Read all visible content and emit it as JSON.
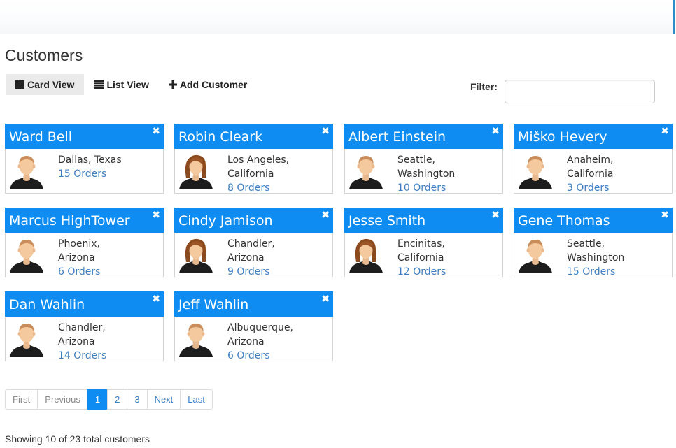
{
  "page": {
    "title": "Customers"
  },
  "toolbar": {
    "card_view": "Card View",
    "list_view": "List View",
    "add_customer": "Add Customer",
    "filter_label": "Filter:",
    "filter_value": ""
  },
  "close_glyph": "✖",
  "customers": [
    {
      "name": "Ward Bell",
      "line1": "Dallas, Texas",
      "line2": "",
      "orders": "15 Orders",
      "gender": "male"
    },
    {
      "name": "Robin Cleark",
      "line1": "Los Angeles,",
      "line2": "California",
      "orders": "8 Orders",
      "gender": "female"
    },
    {
      "name": "Albert Einstein",
      "line1": "Seattle,",
      "line2": "Washington",
      "orders": "10 Orders",
      "gender": "male"
    },
    {
      "name": "Miško Hevery",
      "line1": "Anaheim,",
      "line2": "California",
      "orders": "3 Orders",
      "gender": "male"
    },
    {
      "name": "Marcus HighTower",
      "line1": "Phoenix,",
      "line2": "Arizona",
      "orders": "6 Orders",
      "gender": "male"
    },
    {
      "name": "Cindy Jamison",
      "line1": "Chandler,",
      "line2": "Arizona",
      "orders": "9 Orders",
      "gender": "female"
    },
    {
      "name": "Jesse Smith",
      "line1": "Encinitas,",
      "line2": "California",
      "orders": "12 Orders",
      "gender": "female"
    },
    {
      "name": "Gene Thomas",
      "line1": "Seattle,",
      "line2": "Washington",
      "orders": "15 Orders",
      "gender": "male"
    },
    {
      "name": "Dan Wahlin",
      "line1": "Chandler,",
      "line2": "Arizona",
      "orders": "14 Orders",
      "gender": "male"
    },
    {
      "name": "Jeff Wahlin",
      "line1": "Albuquerque,",
      "line2": "Arizona",
      "orders": "6 Orders",
      "gender": "male"
    }
  ],
  "pagination": {
    "first": "First",
    "previous": "Previous",
    "pages": [
      "1",
      "2",
      "3"
    ],
    "current": "1",
    "next": "Next",
    "last": "Last"
  },
  "summary": "Showing 10 of 23 total customers",
  "colors": {
    "accent": "#0f8cf2",
    "link": "#3f7fc0"
  }
}
